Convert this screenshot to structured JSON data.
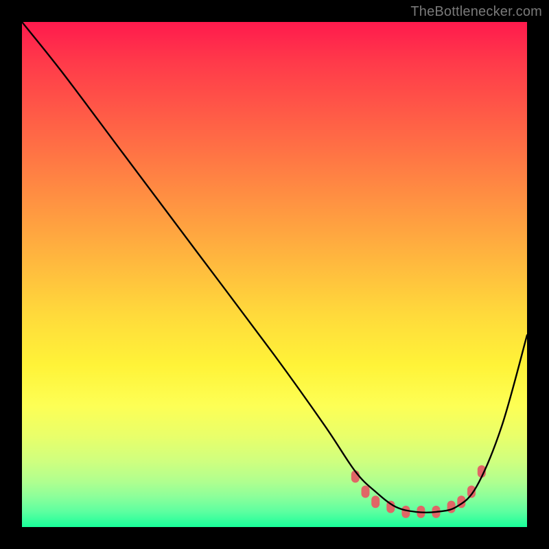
{
  "watermark": "TheBottlenecker.com",
  "chart_data": {
    "type": "line",
    "title": "",
    "xlabel": "",
    "ylabel": "",
    "xlim": [
      0,
      100
    ],
    "ylim": [
      0,
      100
    ],
    "series": [
      {
        "name": "curve",
        "x": [
          0,
          8,
          20,
          35,
          50,
          60,
          66,
          70,
          74,
          78,
          82,
          86,
          90,
          95,
          100
        ],
        "values": [
          100,
          90,
          74,
          54,
          34,
          20,
          11,
          7,
          4,
          3,
          3,
          4,
          8,
          20,
          38
        ]
      }
    ],
    "markers": {
      "name": "dots",
      "color": "#e06666",
      "x": [
        66,
        68,
        70,
        73,
        76,
        79,
        82,
        85,
        87,
        89,
        91
      ],
      "values": [
        10,
        7,
        5,
        4,
        3,
        3,
        3,
        4,
        5,
        7,
        11
      ]
    }
  }
}
